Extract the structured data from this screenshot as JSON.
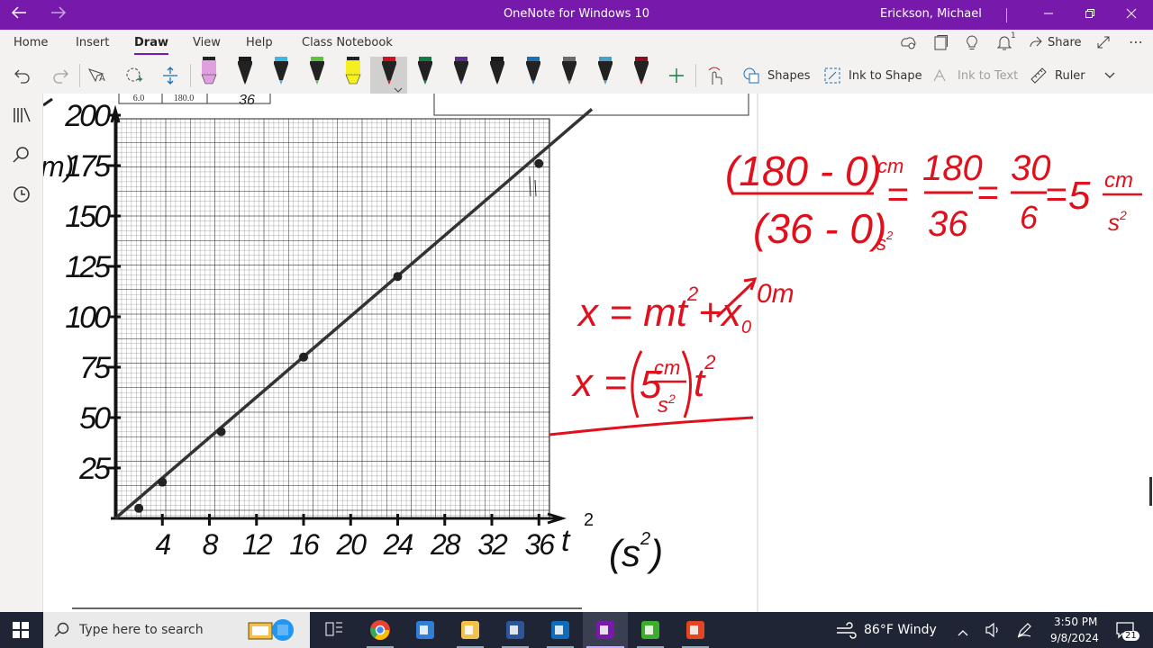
{
  "window": {
    "title": "OneNote for Windows 10",
    "user": "Erickson, Michael",
    "back_icon": "back-arrow-icon",
    "forward_icon": "forward-arrow-icon",
    "controls": [
      "minimize-icon",
      "restore-icon",
      "close-icon"
    ]
  },
  "ribbon": {
    "tabs": [
      "Home",
      "Insert",
      "Draw",
      "View",
      "Help",
      "Class Notebook"
    ],
    "active_tab": "Draw",
    "accent": "#7719aa",
    "share_label": "Share",
    "notification_count": "1"
  },
  "toolbar": {
    "shapes_label": "Shapes",
    "ink_to_shape_label": "Ink to Shape",
    "ink_to_text_label": "Ink to Text",
    "ruler_label": "Ruler",
    "pens": [
      {
        "name": "highlighter-pink",
        "color": "#e0a0e0"
      },
      {
        "name": "pen-black",
        "color": "#1a1a1a"
      },
      {
        "name": "pen-cyan",
        "color": "#3ab7e6"
      },
      {
        "name": "pen-green",
        "color": "#5cc63a"
      },
      {
        "name": "highlighter-yellow",
        "color": "#f5ef20"
      },
      {
        "name": "pen-red",
        "color": "#d01020"
      },
      {
        "name": "pen-dark-green",
        "color": "#107c41"
      },
      {
        "name": "pen-purple",
        "color": "#5c2d91"
      },
      {
        "name": "pen-black-2",
        "color": "#1a1a1a"
      },
      {
        "name": "pen-blue",
        "color": "#1a6fb5"
      },
      {
        "name": "pen-galaxy",
        "color": "#6a6a6a"
      },
      {
        "name": "pen-rainbow",
        "color": "#4aa0c8"
      },
      {
        "name": "pen-dark-red",
        "color": "#8a1020"
      }
    ]
  },
  "graph": {
    "table_values": [
      "6.0",
      "180.0",
      "36"
    ],
    "y_ticks": [
      "25",
      "50",
      "75",
      "100",
      "125",
      "150",
      "175",
      "200"
    ],
    "x_ticks": [
      "4",
      "8",
      "12",
      "16",
      "20",
      "24",
      "28",
      "32",
      "36"
    ],
    "y_unit_fragment": "m)",
    "x_label": "t",
    "x_label_exp": "2",
    "x_unit": "(s",
    "x_unit_exp": "2",
    "x_unit_close": ")",
    "points": [
      [
        2,
        5
      ],
      [
        4,
        18
      ],
      [
        9,
        43
      ],
      [
        16,
        80
      ],
      [
        24,
        120
      ],
      [
        36,
        176
      ]
    ]
  },
  "notes": {
    "slope_numerator": "(180 - 0)",
    "slope_num_unit": "cm",
    "slope_denominator": "(36 - 0)",
    "slope_den_unit": "s",
    "slope_den_exp": "2",
    "eq1": "=",
    "frac1_num": "180",
    "frac1_den": "36",
    "eq2": "=",
    "frac2_num": "30",
    "frac2_den": "6",
    "eq3": "=",
    "result_value": "5",
    "result_unit_num": "cm",
    "result_unit_den": "s",
    "result_unit_den_exp": "2",
    "model_eq": "x = mt",
    "model_exp": "2",
    "model_plus": "+",
    "model_x0": "x",
    "model_x0_sub": "0",
    "model_zero": "0m",
    "final_x": "x =",
    "final_coef": "5",
    "final_unit_num": "cm",
    "final_unit_den": "s",
    "final_unit_den_exp": "2",
    "final_t": "t",
    "final_t_exp": "2",
    "ink_color": "#e0101c"
  },
  "taskbar": {
    "search_placeholder": "Type here to search",
    "weather": "86°F  Windy",
    "time": "3:50 PM",
    "date": "9/8/2024",
    "notifications": "21",
    "apps": [
      "task-view-icon",
      "chrome-icon",
      "store-icon",
      "file-explorer-icon",
      "word-icon",
      "outlook-icon",
      "onenote-icon",
      "camtasia-icon",
      "camtasia-recorder-icon"
    ]
  }
}
